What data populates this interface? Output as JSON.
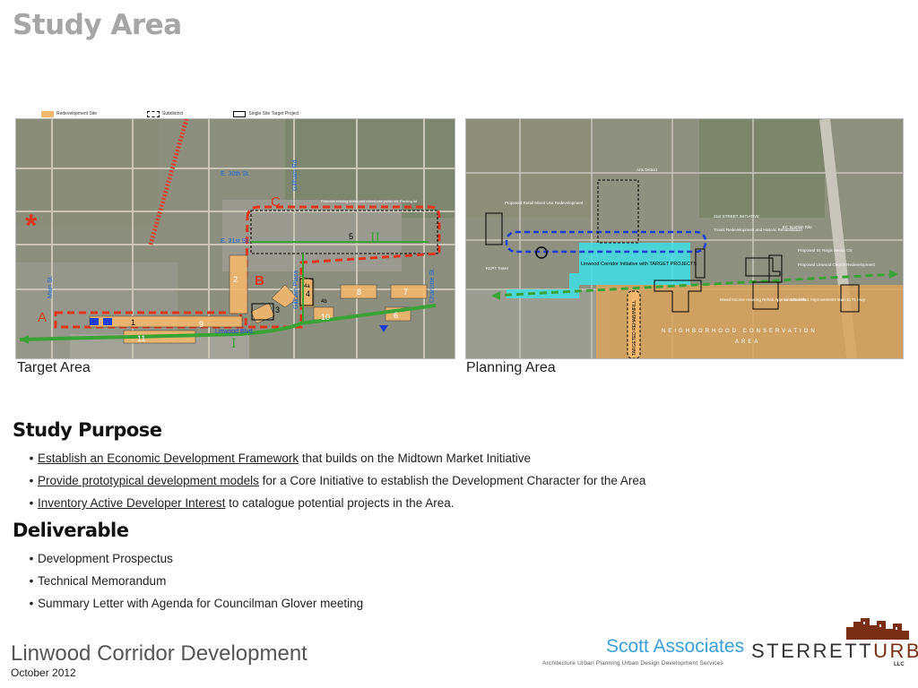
{
  "page": {
    "title": "Study Area"
  },
  "legend": {
    "redevelopment_site": "Redevelopment Site",
    "subdistrict": "Subdistrict",
    "single_site": "Single Site Target Project"
  },
  "target_map": {
    "caption": "Target Area",
    "labels": {
      "e30th": "E. 30th St.",
      "e31st": "E. 31st St.",
      "gillham_rd": "Gillham Rd.",
      "gillham_plaza": "Gillham Plaza",
      "main_st": "Main St.",
      "charlotte": "Charlotte St.",
      "linwood": "Linwood Blvd.",
      "note": "Potential existing street and mixed-use public art, Parking lot",
      "a": "A",
      "b": "B",
      "c": "C",
      "roman1": "I",
      "roman2": "II",
      "s1": "1",
      "s2": "2",
      "s3": "3",
      "s4": "4",
      "s4a": "4a",
      "s4b": "4b",
      "s5": "5",
      "s6": "6",
      "s7": "7",
      "s8": "8",
      "s9": "9",
      "s10": "10",
      "s11": "11",
      "star": "*"
    }
  },
  "planning_map": {
    "caption": "Planning Area",
    "labels": {
      "arts": "Arts District",
      "proposed_retail": "Proposed Retail Mixed Use Redevelopment",
      "kcpt": "KCPT Tower",
      "linwood_corridor": "Linwood Corridor Initiative with TARGET PROJECTS",
      "initiative_31st": "31st STREET INITIATIVE",
      "troost": "Troost Redevelopment and Historic Rehabilitation",
      "scottish": "KC Scottish Rite",
      "st_regis": "Proposed St. Regis Senior Ctr.",
      "church": "Proposed Linwood Church Redevelopment",
      "mixed_income": "Mixed Income Housing Rehab Approx. 130 units",
      "linwood_improvements": "Linwood Blvd. Improvements Main to 71 Hwy",
      "targeted_rehab": "TARGETED REHAB/INFILL",
      "neighborhood": "NEIGHBORHOOD CONSERVATION",
      "area": "AREA"
    }
  },
  "study_purpose": {
    "heading": "Study Purpose",
    "items": [
      {
        "link": "Establish an Economic Development Framework",
        "rest": " that builds on the Midtown Market Initiative"
      },
      {
        "link": "Provide prototypical development models",
        "rest": " for a Core Initiative to establish the Development Character for the Area"
      },
      {
        "link": "Inventory Active Developer Interest",
        "rest": " to catalogue potential projects in the Area."
      }
    ]
  },
  "deliverable": {
    "heading": "Deliverable",
    "items": [
      "Development Prospectus",
      "Technical Memorandum",
      "Summary Letter with Agenda for Councilman Glover meeting"
    ]
  },
  "bullet": "•",
  "footer": {
    "title": "Linwood Corridor Development",
    "date": "October 2012",
    "scott": "Scott Associates",
    "scott_sub": "Architecture Urban Planning Urban Design Development Services",
    "sterrett_a": "STERRETT",
    "sterrett_b": "URBAN",
    "llc": "LLC"
  },
  "colors": {
    "aerial": "#8d8f7e",
    "redevelopment": "#f0b76d",
    "subdistrict_dash": "#e0341c",
    "corridor_green": "#3aa335",
    "linwood_cyan": "#3fe0e6",
    "conservation": "#d9a45e",
    "planning_blue": "#1c3ed6",
    "scott_blue": "#3a9fd6",
    "sterrett_brown": "#7a2f14"
  }
}
